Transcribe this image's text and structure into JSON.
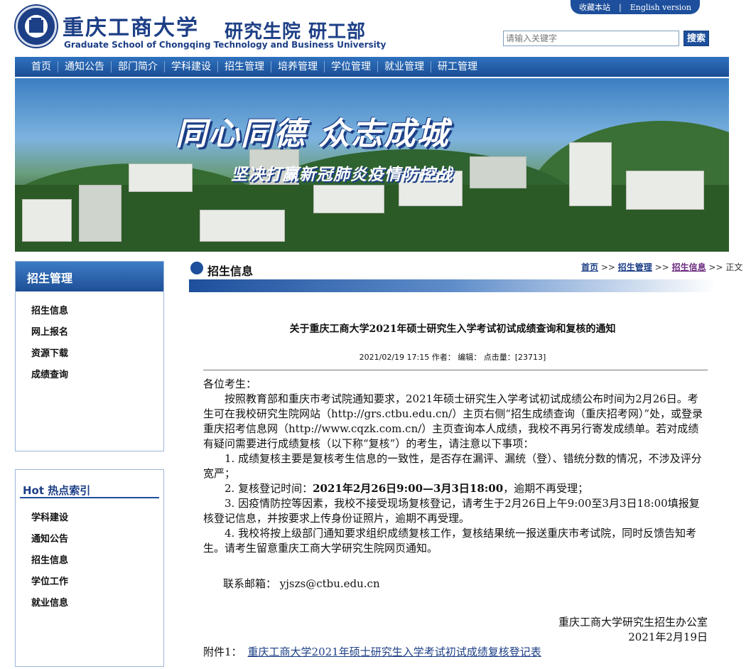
{
  "header": {
    "school_cn": "重庆工商大学",
    "dept_cn": "研究生院 研工部",
    "school_en": "Graduate School of Chongqing Technology and Business University",
    "top_links": [
      "收藏本站",
      "|",
      "English version"
    ],
    "search_placeholder": "请输入关键字",
    "search_button": "搜索"
  },
  "nav": {
    "items": [
      "首页",
      "通知公告",
      "部门简介",
      "学科建设",
      "招生管理",
      "培养管理",
      "学位管理",
      "就业管理",
      "研工管理"
    ]
  },
  "banner": {
    "slogan_main": "同心同德   众志成城",
    "slogan_sub": "坚决打赢新冠肺炎疫情防控战"
  },
  "sidebar": {
    "box1_title": "招生管理",
    "box1_items": [
      "招生信息",
      "网上报名",
      "资源下载",
      "成绩查询"
    ],
    "box2_title": "Hot 热点索引",
    "box2_items": [
      "学科建设",
      "通知公告",
      "招生信息",
      "学位工作",
      "就业信息"
    ]
  },
  "content": {
    "section_title": "招生信息",
    "breadcrumb": [
      "首页",
      ">>",
      "招生管理",
      ">>",
      "招生信息",
      ">>",
      "正文"
    ],
    "article_title": "关于重庆工商大学2021年硕士研究生入学考试初试成绩查询和复核的通知",
    "meta": "2021/02/19 17:15  作者：  编辑：  点击量：[23713]",
    "greeting": "各位考生：",
    "para1": "按照教育部和重庆市考试院通知要求，2021年硕士研究生入学考试初试成绩公布时间为2月26日。考生可在我校研究生院网站（http://grs.ctbu.edu.cn/）主页右侧“招生成绩查询（重庆招考网）”处，或登录重庆招考信息网（http://www.cqzk.com.cn/）主页查询本人成绩，我校不再另行寄发成绩单。若对成绩有疑问需要进行成绩复核（以下称“复核”）的考生，请注意以下事项：",
    "item1": "1. 成绩复核主要是复核考生信息的一致性，是否存在漏评、漏统（登）、错统分数的情况，不涉及评分宽严；",
    "item2_prefix": "2. 复核登记时间：",
    "item2_bold": "2021年2月26日9:00—3月3日18:00",
    "item2_suffix": "，逾期不再受理；",
    "item3": "3. 因疫情防控等因素，我校不接受现场复核登记，请考生于2月26日上午9:00至3月3日18:00填报复核登记信息，并按要求上传身份证照片，逾期不再受理。",
    "item4": "4. 我校将按上级部门通知要求组织成绩复核工作，复核结果统一报送重庆市考试院，同时反馈告知考生。请考生留意重庆工商大学研究生院网页通知。",
    "email_line": "联系邮箱：  yjszs@ctbu.edu.cn",
    "signature_org": "重庆工商大学研究生招生办公室",
    "signature_date": "2021年2月19日",
    "attachment_label": "附件1：",
    "attachment_link": "重庆工商大学2021年硕士研究生入学考试初试成绩复核登记表"
  },
  "colors": {
    "brand_blue": "#1d3f86",
    "nav_blue": "#1d4f9c",
    "link_visited": "#6b2a7e"
  }
}
